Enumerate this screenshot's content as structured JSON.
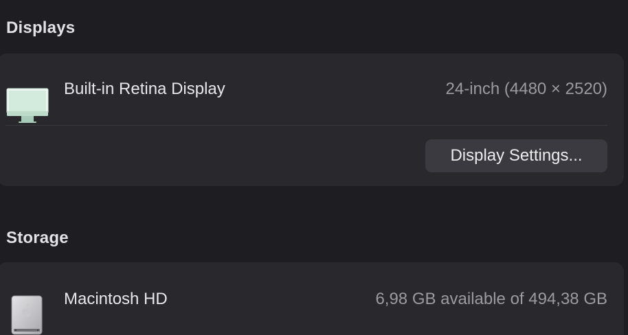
{
  "displays": {
    "title": "Displays",
    "items": [
      {
        "icon": "imac-display-icon",
        "name": "Built-in Retina Display",
        "spec": "24-inch (4480 × 2520)"
      }
    ],
    "settings_button_label": "Display Settings..."
  },
  "storage": {
    "title": "Storage",
    "items": [
      {
        "icon": "hard-disk-icon",
        "name": "Macintosh HD",
        "capacity": "6,98 GB available of 494,38 GB"
      }
    ]
  },
  "colors": {
    "background": "#1e1d21",
    "card": "#29282d",
    "button": "#3b3a40",
    "secondary_text": "#9c9b9f",
    "display_accent": "#c9e6d6"
  }
}
